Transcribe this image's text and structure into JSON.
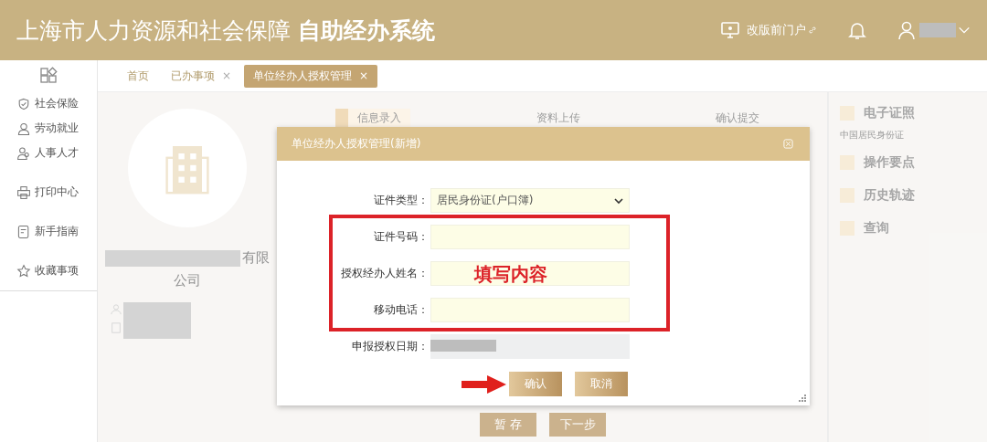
{
  "header": {
    "title": "上海市人力资源和社会保障 **自助经办系统**",
    "portal_link": "改版前门户"
  },
  "sidebar": {
    "items": [
      {
        "label": "社会保险",
        "kind": "shield"
      },
      {
        "label": "劳动就业",
        "kind": "worker"
      },
      {
        "label": "人事人才",
        "kind": "people"
      },
      {
        "label": "打印中心",
        "kind": "printer"
      },
      {
        "label": "新手指南",
        "kind": "guide"
      },
      {
        "label": "收藏事项",
        "kind": "star"
      }
    ]
  },
  "tabs": [
    {
      "label": "首页",
      "selected": false
    },
    {
      "label": "已办事项",
      "close": "×",
      "selected": false
    },
    {
      "label": "单位经办人授权管理",
      "close": "×",
      "selected": true
    }
  ],
  "company": {
    "name_visible": "有限",
    "name_line_2": "公司"
  },
  "steps": [
    {
      "label": "信息录入",
      "selected": true
    },
    {
      "label": "资料上传",
      "selected": false
    },
    {
      "label": "确认提交",
      "selected": false
    }
  ],
  "page_buttons": [
    "暂 存",
    "下一步"
  ],
  "right_panel": {
    "items": [
      {
        "label": "电子证照",
        "note": "中国居民身份证"
      },
      {
        "label": "操作要点"
      },
      {
        "label": "历史轨迹"
      },
      {
        "label": "查询"
      }
    ]
  },
  "dialog": {
    "title": "单位经办人授权管理(新增)",
    "fields": [
      {
        "label": "证件类型：",
        "kind": "select",
        "value": "居民身份证(户口簿)"
      },
      {
        "label": "证件号码：",
        "kind": "input"
      },
      {
        "label": "授权经办人姓名：",
        "kind": "input"
      },
      {
        "label": "移动电话：",
        "kind": "input"
      },
      {
        "label": "申报授权日期：",
        "kind": "readonly"
      }
    ],
    "buttons": [
      "确认",
      "取消"
    ],
    "annotation": "填写内容"
  }
}
